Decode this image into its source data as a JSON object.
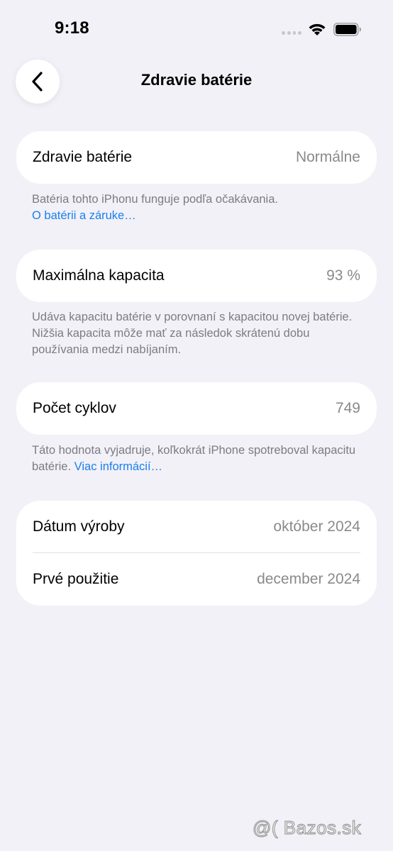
{
  "status_bar": {
    "time": "9:18"
  },
  "nav": {
    "title": "Zdravie batérie"
  },
  "battery_health": {
    "label": "Zdravie batérie",
    "value": "Normálne",
    "footnote": "Batéria tohto iPhonu funguje podľa očakávania.",
    "link": "O batérii a záruke…"
  },
  "max_capacity": {
    "label": "Maximálna kapacita",
    "value": "93 %",
    "footnote": "Udáva kapacitu batérie v porovnaní s kapacitou novej batérie. Nižšia kapacita môže mať za následok skrátenú dobu používania medzi nabíjaním."
  },
  "cycle_count": {
    "label": "Počet cyklov",
    "value": "749",
    "footnote": "Táto hodnota vyjadruje, koľkokrát iPhone spotreboval kapacitu batérie.",
    "link": "Viac informácií…"
  },
  "dates": {
    "manufacture_label": "Dátum výroby",
    "manufacture_value": "október 2024",
    "first_use_label": "Prvé použitie",
    "first_use_value": "december 2024"
  },
  "watermark": "@( Bazos.sk",
  "colors": {
    "background": "#f2f1f7",
    "card": "#ffffff",
    "link": "#1a7ff0",
    "secondary_text": "#8a8a8e"
  }
}
